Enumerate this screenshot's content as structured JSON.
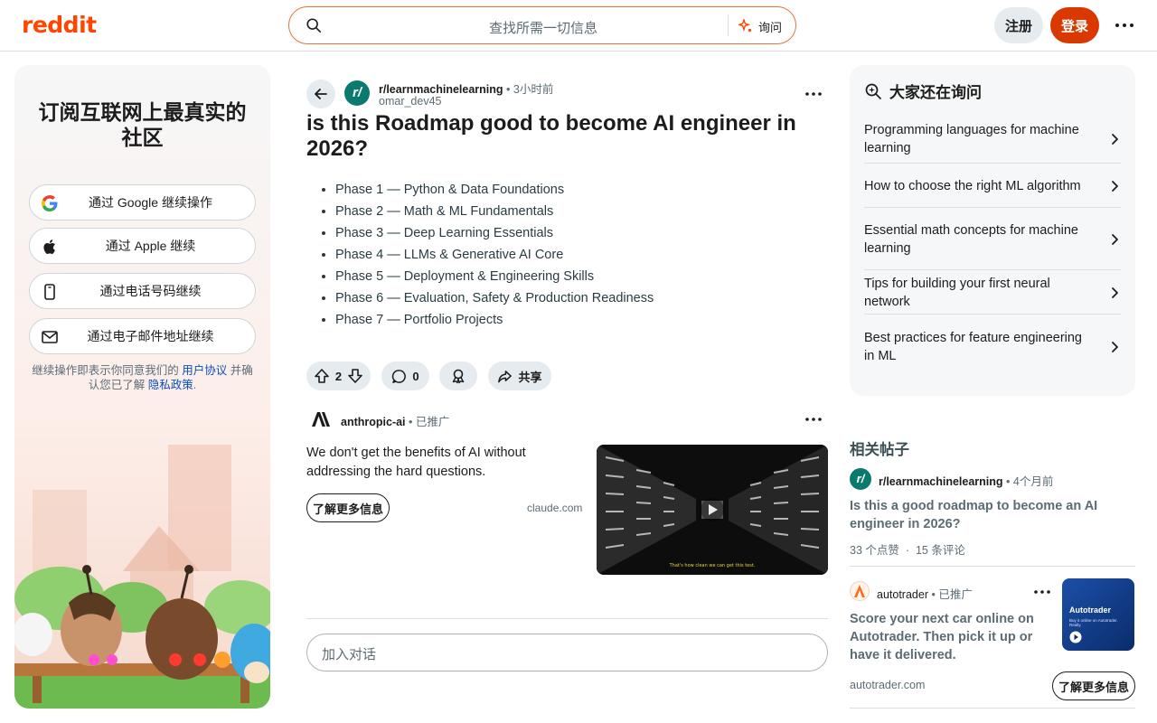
{
  "header": {
    "logo": "reddit",
    "search_placeholder": "查找所需一切信息",
    "ask_label": "询问",
    "signup_label": "注册",
    "login_label": "登录"
  },
  "left_panel": {
    "title": "订阅互联网上最真实的社区",
    "auth_buttons": [
      {
        "label": "通过 Google 继续操作",
        "icon": "google-icon"
      },
      {
        "label": "通过 Apple 继续",
        "icon": "apple-icon"
      },
      {
        "label": "通过电话号码继续",
        "icon": "phone-icon"
      },
      {
        "label": "通过电子邮件地址继续",
        "icon": "mail-icon"
      }
    ],
    "legal_prefix": "继续操作即表示你同意我们的",
    "user_agreement": "用户协议",
    "legal_middle": "并确认您已了解",
    "privacy_policy": "隐私政策",
    "legal_suffix": "."
  },
  "post": {
    "subreddit": "r/learnmachinelearning",
    "time": "3小时前",
    "author": "omar_dev45",
    "title": "is this Roadmap good to become AI engineer in 2026?",
    "phases": [
      "Phase 1 — Python & Data Foundations",
      "Phase 2 — Math & ML Fundamentals",
      "Phase 3 — Deep Learning Essentials",
      "Phase 4 — LLMs & Generative AI Core",
      "Phase 5 — Deployment & Engineering Skills",
      "Phase 6 — Evaluation, Safety & Production Readiness",
      "Phase 7 — Portfolio Projects"
    ],
    "votes": "2",
    "comments": "0",
    "share_label": "共享"
  },
  "promoted": {
    "name": "anthropic-ai",
    "tag": "已推广",
    "text": "We don't get the benefits of AI without addressing the hard questions.",
    "learn_more": "了解更多信息",
    "domain": "claude.com",
    "image_caption": "That's how clean we can get this test."
  },
  "comment_box": {
    "placeholder": "加入对话"
  },
  "ask_card": {
    "title": "大家还在询问",
    "questions": [
      "Programming languages for machine learning",
      "How to choose the right ML algorithm",
      "Essential math concepts for machine learning",
      "Tips for building your first neural network",
      "Best practices for feature engineering in ML"
    ]
  },
  "related": {
    "title": "相关帖子",
    "subreddit": "r/learnmachinelearning",
    "time": "4个月前",
    "post_title": "Is this a good roadmap to become an AI engineer in 2026?",
    "upvotes": "33 个点赞",
    "comments": "15 条评论",
    "ad_name": "autotrader",
    "ad_tag": "已推广",
    "ad_text": "Score your next car online on Autotrader. Then pick it up or have it delivered.",
    "ad_domain": "autotrader.com",
    "ad_learn_more": "了解更多信息",
    "ad_image_brand": "Autotrader",
    "ad_image_tagline": "Buy it online on Autotrader. Really."
  },
  "colors": {
    "brand": "#ff4500",
    "login": "#d93900",
    "link": "#0a4fbf",
    "community": "#0b7a6e"
  }
}
